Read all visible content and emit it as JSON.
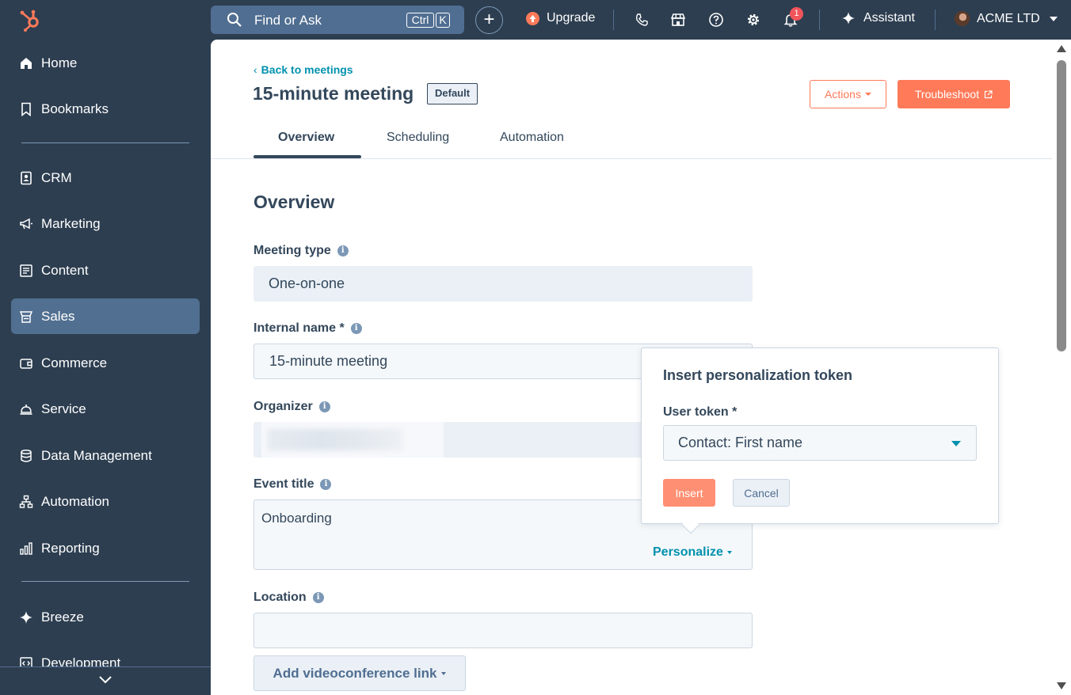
{
  "topbar": {
    "search_placeholder": "Find or Ask",
    "shortcut_ctrl": "Ctrl",
    "shortcut_key": "K",
    "upgrade_label": "Upgrade",
    "notification_count": "1",
    "assistant_label": "Assistant",
    "account_name": "ACME LTD"
  },
  "sidebar": {
    "items": [
      {
        "label": "Home",
        "icon": "home-icon"
      },
      {
        "label": "Bookmarks",
        "icon": "bookmark-icon"
      },
      {
        "label": "CRM",
        "icon": "contacts-icon"
      },
      {
        "label": "Marketing",
        "icon": "megaphone-icon"
      },
      {
        "label": "Content",
        "icon": "content-icon"
      },
      {
        "label": "Sales",
        "icon": "sales-icon",
        "active": true
      },
      {
        "label": "Commerce",
        "icon": "wallet-icon"
      },
      {
        "label": "Service",
        "icon": "bell-icon"
      },
      {
        "label": "Data Management",
        "icon": "database-icon"
      },
      {
        "label": "Automation",
        "icon": "workflow-icon"
      },
      {
        "label": "Reporting",
        "icon": "bar-chart-icon"
      },
      {
        "label": "Breeze",
        "icon": "sparkle-icon"
      },
      {
        "label": "Development",
        "icon": "code-icon"
      }
    ]
  },
  "page": {
    "back_link": "Back to meetings",
    "title": "15-minute meeting",
    "default_badge": "Default",
    "actions_label": "Actions",
    "troubleshoot_label": "Troubleshoot",
    "tabs": [
      "Overview",
      "Scheduling",
      "Automation"
    ],
    "active_tab": "Overview",
    "section_title": "Overview"
  },
  "form": {
    "meeting_type_label": "Meeting type",
    "meeting_type_value": "One-on-one",
    "internal_name_label": "Internal name *",
    "internal_name_value": "15-minute meeting",
    "organizer_label": "Organizer",
    "event_title_label": "Event title",
    "event_title_value": "Onboarding",
    "personalize_label": "Personalize",
    "location_label": "Location",
    "location_value": "",
    "videoconference_label": "Add videoconference link"
  },
  "popover": {
    "title": "Insert personalization token",
    "token_label": "User token *",
    "token_value": "Contact: First name",
    "insert_label": "Insert",
    "cancel_label": "Cancel"
  },
  "colors": {
    "nav_bg": "#2d3e50",
    "active_nav": "#516f90",
    "accent_orange": "#ff7a59",
    "link_teal": "#0091ae",
    "text_dark": "#33475b"
  }
}
